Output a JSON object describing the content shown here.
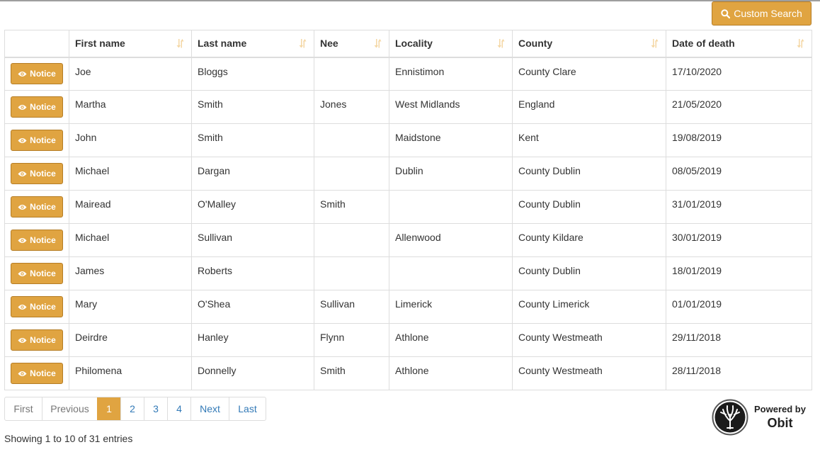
{
  "toolbar": {
    "custom_search_label": "Custom Search"
  },
  "table": {
    "notice_label": "Notice",
    "columns": [
      "",
      "First name",
      "Last name",
      "Nee",
      "Locality",
      "County",
      "Date of death"
    ],
    "rows": [
      [
        "Joe",
        "Bloggs",
        "",
        "Ennistimon",
        "County Clare",
        "17/10/2020"
      ],
      [
        "Martha",
        "Smith",
        "Jones",
        "West Midlands",
        "England",
        "21/05/2020"
      ],
      [
        "John",
        "Smith",
        "",
        "Maidstone",
        "Kent",
        "19/08/2019"
      ],
      [
        "Michael",
        "Dargan",
        "",
        "Dublin",
        "County Dublin",
        "08/05/2019"
      ],
      [
        "Mairead",
        "O'Malley",
        "Smith",
        "",
        "County Dublin",
        "31/01/2019"
      ],
      [
        "Michael",
        "Sullivan",
        "",
        "Allenwood",
        "County Kildare",
        "30/01/2019"
      ],
      [
        "James",
        "Roberts",
        "",
        "",
        "County Dublin",
        "18/01/2019"
      ],
      [
        "Mary",
        "O'Shea",
        "Sullivan",
        "Limerick",
        "County Limerick",
        "01/01/2019"
      ],
      [
        "Deirdre",
        "Hanley",
        "Flynn",
        "Athlone",
        "County Westmeath",
        "29/11/2018"
      ],
      [
        "Philomena",
        "Donnelly",
        "Smith",
        "Athlone",
        "County Westmeath",
        "28/11/2018"
      ]
    ]
  },
  "pagination": {
    "first": "First",
    "previous": "Previous",
    "pages": [
      "1",
      "2",
      "3",
      "4"
    ],
    "active_page": "1",
    "next": "Next",
    "last": "Last"
  },
  "info": "Showing 1 to 10 of 31 entries",
  "footer": {
    "powered_by": "Powered by",
    "brand": "Obit"
  },
  "colors": {
    "accent": "#e0a441",
    "accent_border": "#b57d25",
    "link": "#337ab7",
    "border": "#dddddd"
  },
  "icons": {
    "search": "search-icon",
    "notice": "eye-icon",
    "sort": "sort-icon",
    "logo": "tree-logo-icon"
  }
}
